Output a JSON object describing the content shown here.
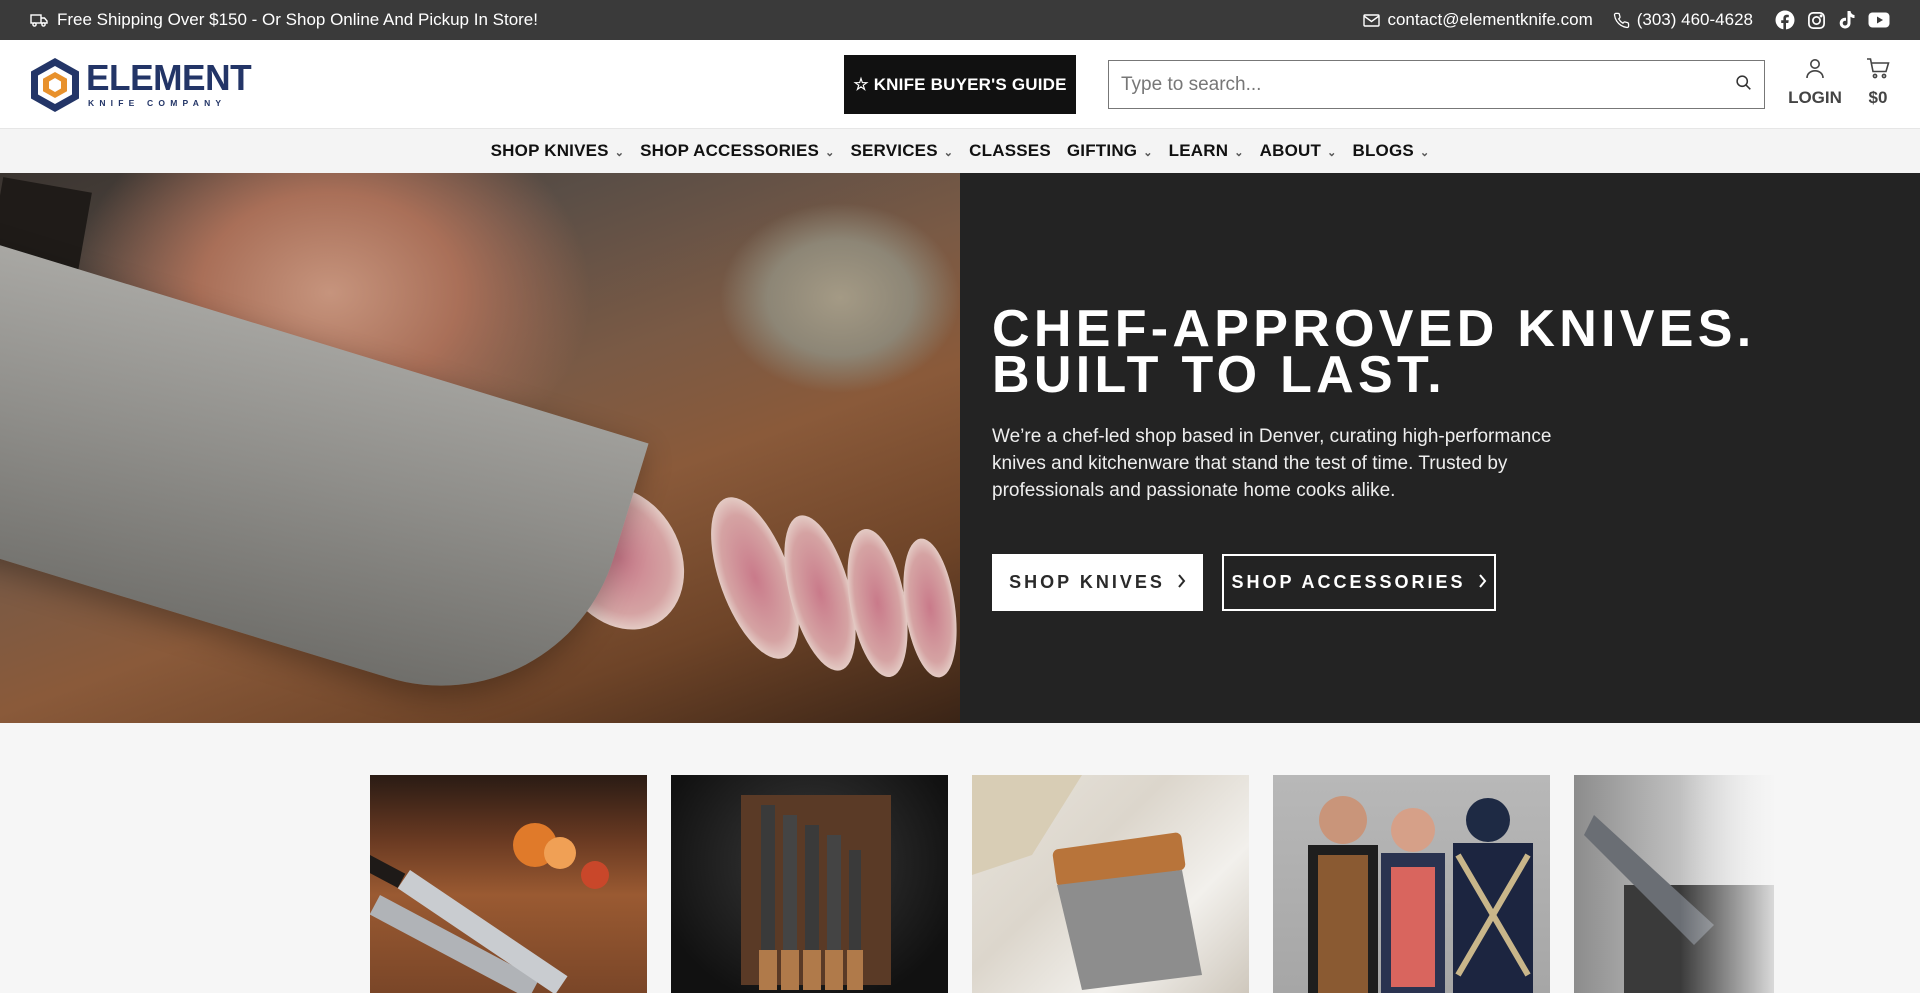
{
  "announcement": {
    "shipping_icon": "truck-icon",
    "text": "Free Shipping Over $150 - Or Shop Online And Pickup In Store!",
    "email": "contact@elementknife.com",
    "phone": "(303) 460-4628",
    "social": [
      "facebook-icon",
      "instagram-icon",
      "tiktok-icon",
      "youtube-icon"
    ]
  },
  "header": {
    "logo_word": "ELEMENT",
    "logo_sub": "KNIFE COMPANY",
    "buyers_guide_label": "☆ KNIFE BUYER'S GUIDE",
    "search_placeholder": "Type to search...",
    "login_label": "LOGIN",
    "cart_total": "$0"
  },
  "nav": {
    "items": [
      {
        "label": "SHOP KNIVES",
        "dropdown": true
      },
      {
        "label": "SHOP ACCESSORIES",
        "dropdown": true
      },
      {
        "label": "SERVICES",
        "dropdown": true
      },
      {
        "label": "CLASSES",
        "dropdown": false
      },
      {
        "label": "GIFTING",
        "dropdown": true
      },
      {
        "label": "LEARN",
        "dropdown": true
      },
      {
        "label": "ABOUT",
        "dropdown": true
      },
      {
        "label": "BLOGS",
        "dropdown": true
      }
    ]
  },
  "hero": {
    "title_line1": "CHEF-APPROVED KNIVES.",
    "title_line2": "BUILT TO LAST.",
    "description": "We’re a chef-led shop based in Denver, curating high-performance knives and kitchenware that stand the test of time. Trusted by professionals and passionate home cooks alike.",
    "btn_knives": "SHOP KNIVES",
    "btn_accessories": "SHOP ACCESSORIES"
  },
  "colors": {
    "topbar": "#3a3a3a",
    "brand_navy": "#233567",
    "brand_orange": "#e8912c",
    "hero_bg": "#232323"
  }
}
